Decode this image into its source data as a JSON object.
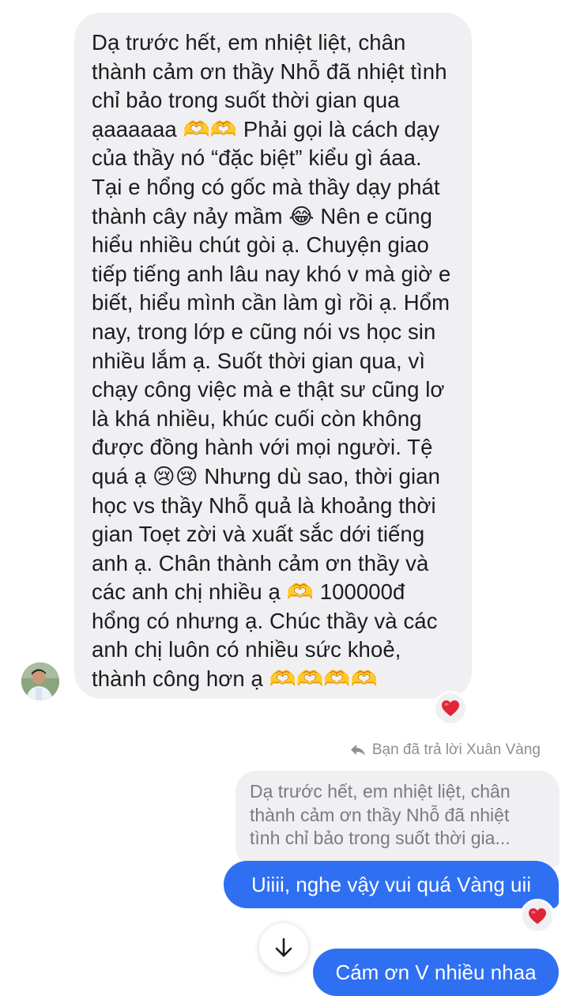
{
  "conversation": {
    "incoming_message": {
      "text": "Dạ trước hết, em nhiệt liệt, chân\nthành cảm ơn thầy Nhỗ đã nhiệt tình\nchỉ bảo trong suốt thời gian qua\nạaaaaaa 🫶🫶 Phải gọi là cách dạy\ncủa thầy nó “đặc biệt” kiểu gì áaa.\nTại e hổng có gốc mà thầy dạy phát\nthành cây nảy mầm 😂 Nên e cũng\nhiểu nhiều chút gòi ạ. Chuyện giao\ntiếp tiếng anh lâu nay khó v mà giờ e\nbiết, hiểu mình cần làm gì rồi ạ. Hổm\nnay, trong lớp e cũng nói vs học sin\nnhiều lắm ạ. Suốt thời gian qua, vì\nchạy công việc mà e thật sư cũng lơ\nlà khá nhiều, khúc cuối còn không\nđược đồng hành với mọi người. Tệ\nquá ạ 😢😢 Nhưng dù sao, thời gian\nhọc vs thầy Nhỗ quả là khoảng thời\ngian Toẹt zời và xuất sắc dới tiếng\nanh ạ. Chân thành cảm ơn thầy và\ncác anh chị nhiều ạ 🫶 100000đ\nhổng có nhưng ạ. Chúc thầy và các\nanh chị luôn có nhiều sức khoẻ,\nthành công hơn ạ 🫶🫶🫶🫶",
      "reaction": "❤️"
    },
    "reply_header": "Bạn đã trả lời Xuân Vàng",
    "quoted_text": "Dạ trước hết, em nhiệt liệt, chân\nthành cảm ơn thầy Nhỗ đã nhiệt\ntình chỉ bảo trong suốt thời gia...",
    "outgoing_messages": [
      {
        "text": "Uiiii, nghe vậy vui quá Vàng uii",
        "reaction": "❤️"
      },
      {
        "text": "Cám ơn V nhiều nhaa"
      }
    ],
    "icons": {
      "reply": "reply-arrow-icon",
      "scroll": "arrow-down-icon",
      "reaction": "heart-icon"
    },
    "colors": {
      "outgoing_bubble": "#2f6ff2",
      "incoming_bubble": "#f0f0f2",
      "heart": "#e0253a",
      "meta_text": "#8e8e93"
    }
  }
}
